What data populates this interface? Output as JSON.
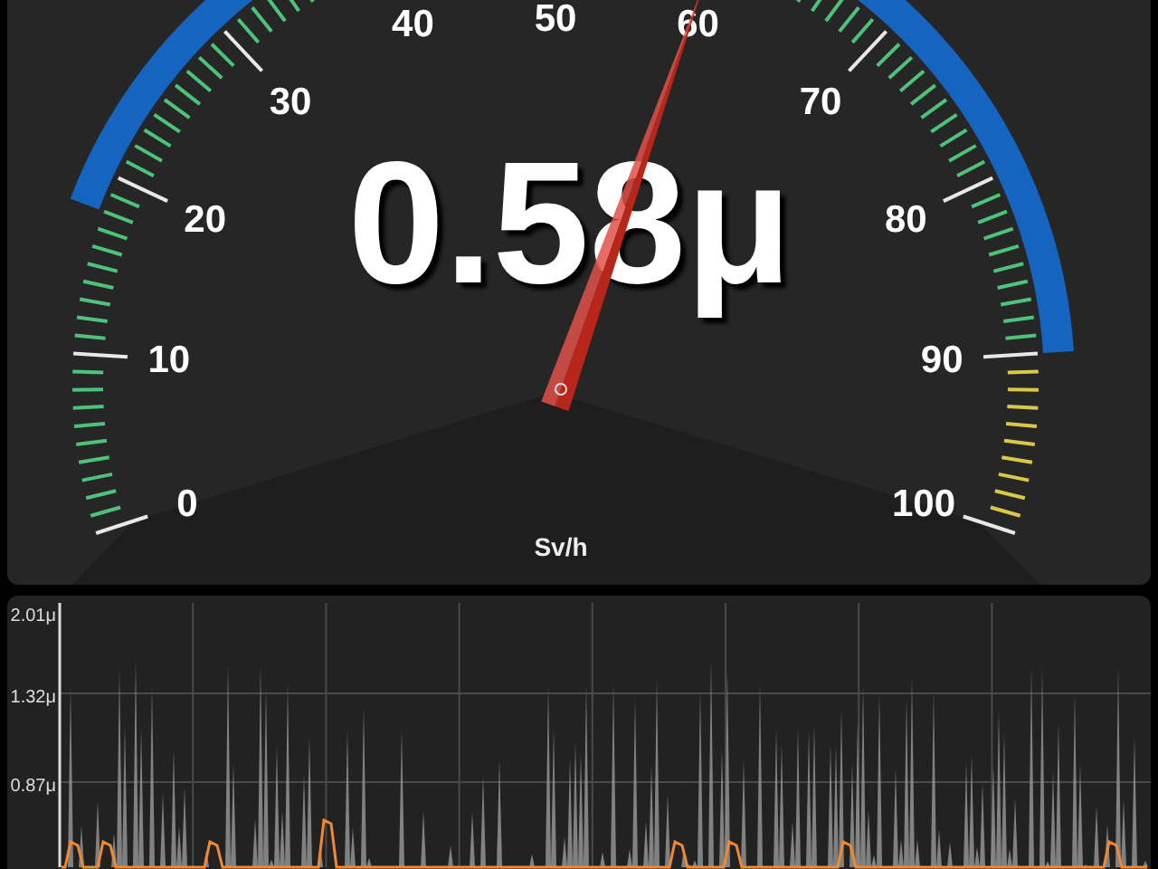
{
  "gauge": {
    "reading": "0.58μ",
    "unit": "Sv/h",
    "top_scale_label": "50",
    "left_scale_labels": [
      "40",
      "30",
      "20",
      "10",
      "0"
    ],
    "right_scale_labels": [
      "60",
      "70",
      "80",
      "90",
      "100"
    ]
  },
  "history": {
    "y_labels": [
      "2.01μ",
      "1.32μ",
      "0.87μ"
    ]
  }
}
